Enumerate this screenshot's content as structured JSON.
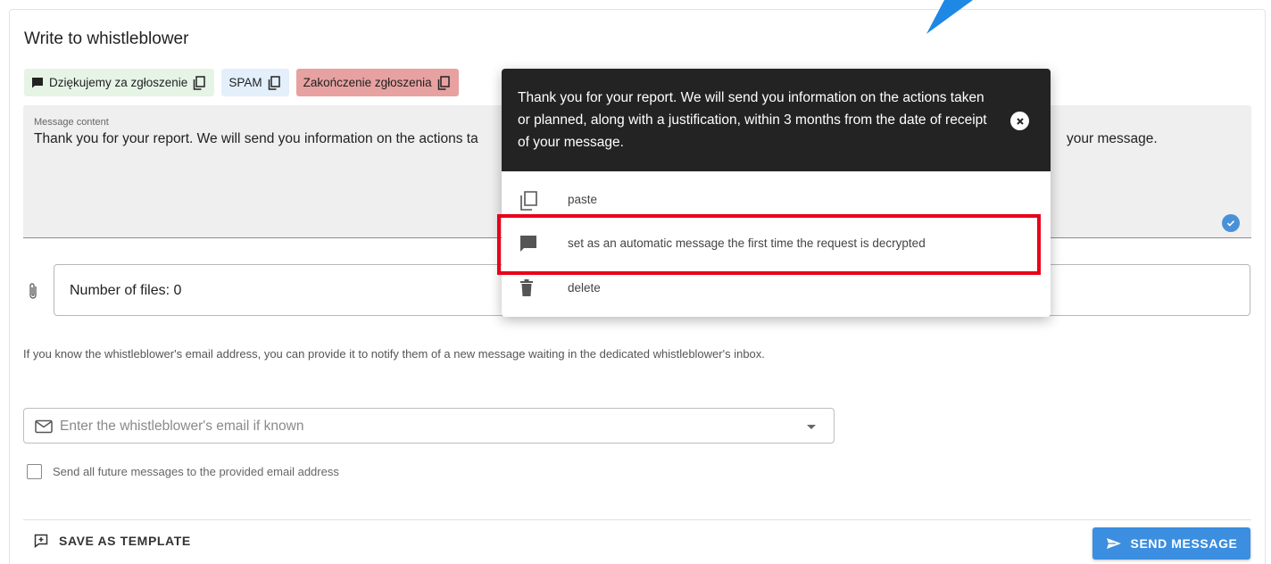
{
  "panel": {
    "title": "Write to whistleblower"
  },
  "templates": [
    {
      "label": "Dziękujemy za zgłoszenie",
      "color": "#e6f4e6"
    },
    {
      "label": "SPAM",
      "color": "#e3effb"
    },
    {
      "label": "Zakończenie zgłoszenia",
      "color": "#e7a1a1"
    }
  ],
  "message": {
    "label": "Message content",
    "text_visible_start": "Thank you for your report. We will send you information on the actions ta",
    "text_visible_end": "your message."
  },
  "attachments": {
    "files_label": "Number of files: 0"
  },
  "email_section": {
    "info": "If you know the whistleblower's email address, you can provide it to notify them of a new message waiting in the dedicated whistleblower's inbox.",
    "placeholder": "Enter the whistleblower's email if known",
    "future_checkbox_label": "Send all future messages to the provided email address",
    "future_checked": false
  },
  "footer": {
    "save_template": "SAVE AS TEMPLATE",
    "send_message": "SEND MESSAGE"
  },
  "popup": {
    "preview_text": "Thank you for your report. We will send you information on the actions taken or planned, along with a justification, within 3 months from the date of receipt of your message.",
    "items": [
      {
        "label": "paste",
        "icon": "copy-icon"
      },
      {
        "label": "set as an automatic message the first time the request is decrypted",
        "icon": "message-icon"
      },
      {
        "label": "delete",
        "icon": "trash-icon"
      }
    ]
  },
  "colors": {
    "accent": "#3b8ee0",
    "highlight": "#e8001a",
    "popup_header": "#232323",
    "arrow": "#1e88e5"
  }
}
